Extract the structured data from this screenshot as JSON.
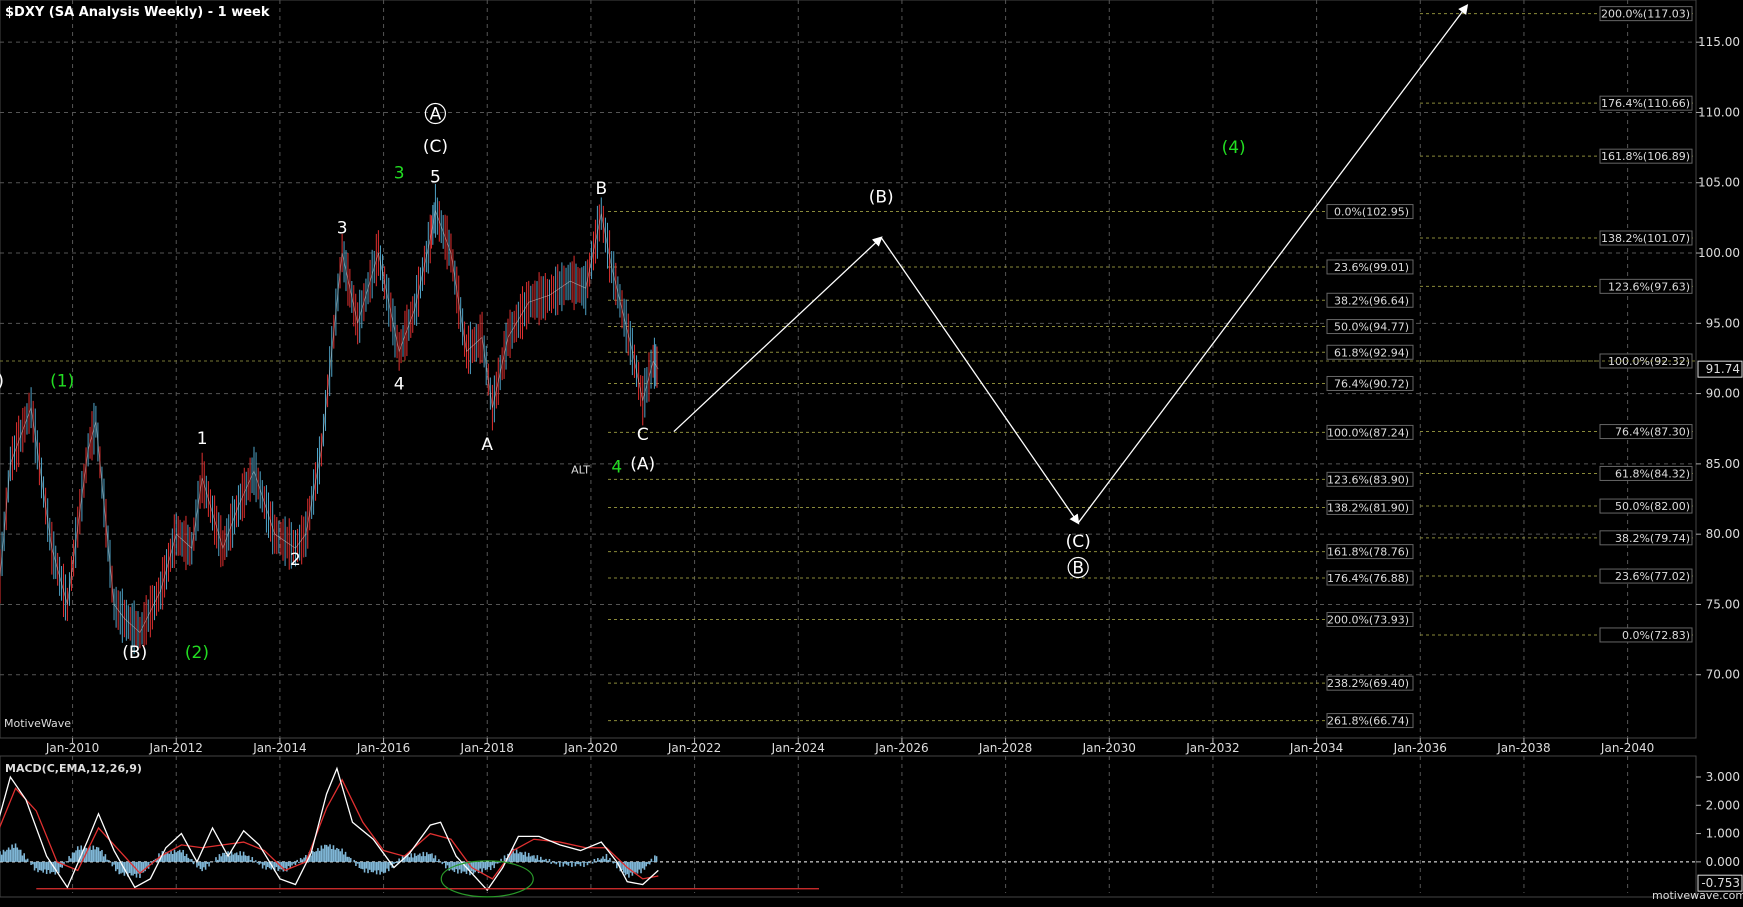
{
  "header": {
    "title": "$DXY (SA Analysis Weekly) - 1 week",
    "watermark": "MotiveWave",
    "footer_site": "motivewave.com",
    "last_price": "91.74"
  },
  "colors": {
    "background": "#000000",
    "grid": "#555555",
    "up_bar": "#4fa3c7",
    "down_bar": "#e03030",
    "fib_line": "#8a8a3a",
    "wave_label": "#ffffff",
    "alt_label": "#22dd22",
    "macd_line": "#ffffff",
    "signal_line": "#e03030",
    "histogram": "#7fb6d6"
  },
  "chart_data": {
    "type": "line",
    "title": "$DXY (SA Analysis Weekly) - 1 week",
    "x_axis": {
      "type": "date",
      "range": [
        "2008-06",
        "2041-06"
      ],
      "tick_labels": [
        "Jan-2010",
        "Jan-2012",
        "Jan-2014",
        "Jan-2016",
        "Jan-2018",
        "Jan-2020",
        "Jan-2022",
        "Jan-2024",
        "Jan-2026",
        "Jan-2028",
        "Jan-2030",
        "Jan-2032",
        "Jan-2034",
        "Jan-2036",
        "Jan-2038",
        "Jan-2040"
      ]
    },
    "y_axis": {
      "ylim": [
        65.5,
        118
      ],
      "tick_labels": [
        "70.00",
        "75.00",
        "80.00",
        "85.00",
        "90.00",
        "95.00",
        "100.00",
        "105.00",
        "110.00",
        "115.00"
      ]
    },
    "grid": true,
    "series": [
      {
        "values": [
          [
            2008.6,
            77
          ],
          [
            2008.8,
            85
          ],
          [
            2009.2,
            89
          ],
          [
            2009.6,
            79
          ],
          [
            2009.9,
            75
          ],
          [
            2010.3,
            86
          ],
          [
            2010.45,
            88
          ],
          [
            2010.8,
            75
          ],
          [
            2011.0,
            74
          ],
          [
            2011.3,
            73
          ],
          [
            2011.7,
            76
          ],
          [
            2012.0,
            80
          ],
          [
            2012.3,
            79
          ],
          [
            2012.5,
            84
          ],
          [
            2012.9,
            79
          ],
          [
            2013.2,
            82
          ],
          [
            2013.5,
            84.5
          ],
          [
            2013.9,
            80
          ],
          [
            2014.3,
            79
          ],
          [
            2014.5,
            80
          ],
          [
            2014.8,
            86
          ],
          [
            2015.0,
            93
          ],
          [
            2015.2,
            100
          ],
          [
            2015.5,
            95
          ],
          [
            2015.9,
            100
          ],
          [
            2016.3,
            93
          ],
          [
            2016.6,
            96
          ],
          [
            2016.9,
            101
          ],
          [
            2017.0,
            103
          ],
          [
            2017.3,
            100
          ],
          [
            2017.6,
            93
          ],
          [
            2017.9,
            94
          ],
          [
            2018.1,
            89
          ],
          [
            2018.4,
            94
          ],
          [
            2018.8,
            96.5
          ],
          [
            2019.2,
            97
          ],
          [
            2019.6,
            98
          ],
          [
            2019.9,
            97.5
          ],
          [
            2020.2,
            102.8
          ],
          [
            2020.4,
            99
          ],
          [
            2020.6,
            96
          ],
          [
            2020.8,
            93
          ],
          [
            2021.0,
            89.5
          ],
          [
            2021.2,
            92.3
          ],
          [
            2021.3,
            91.74
          ]
        ]
      }
    ],
    "projection_path": [
      [
        "2021.6",
        "87.3"
      ],
      [
        "2025.6",
        "101.1"
      ],
      [
        "2029.4",
        "80.8"
      ],
      [
        "2036.9",
        "117.6"
      ]
    ],
    "fib_left": [
      {
        "label": "0.0%(102.95)",
        "value": 102.95
      },
      {
        "label": "23.6%(99.01)",
        "value": 99.01
      },
      {
        "label": "38.2%(96.64)",
        "value": 96.64
      },
      {
        "label": "50.0%(94.77)",
        "value": 94.77
      },
      {
        "label": "61.8%(92.94)",
        "value": 92.94
      },
      {
        "label": "76.4%(90.72)",
        "value": 90.72
      },
      {
        "label": "100.0%(87.24)",
        "value": 87.24
      },
      {
        "label": "123.6%(83.90)",
        "value": 83.9
      },
      {
        "label": "138.2%(81.90)",
        "value": 81.9
      },
      {
        "label": "161.8%(78.76)",
        "value": 78.76
      },
      {
        "label": "176.4%(76.88)",
        "value": 76.88
      },
      {
        "label": "200.0%(73.93)",
        "value": 73.93
      },
      {
        "label": "238.2%(69.40)",
        "value": 69.4
      },
      {
        "label": "261.8%(66.74)",
        "value": 66.74
      }
    ],
    "fib_right": [
      {
        "label": "200.0%(117.03)",
        "value": 117.03
      },
      {
        "label": "176.4%(110.66)",
        "value": 110.66
      },
      {
        "label": "161.8%(106.89)",
        "value": 106.89
      },
      {
        "label": "138.2%(101.07)",
        "value": 101.07
      },
      {
        "label": "123.6%(97.63)",
        "value": 97.63
      },
      {
        "label": "100.0%(92.32)",
        "value": 92.32
      },
      {
        "label": "76.4%(87.30)",
        "value": 87.3
      },
      {
        "label": "61.8%(84.32)",
        "value": 84.32
      },
      {
        "label": "50.0%(82.00)",
        "value": 82.0
      },
      {
        "label": "38.2%(79.74)",
        "value": 79.74
      },
      {
        "label": "23.6%(77.02)",
        "value": 77.02
      },
      {
        "label": "0.0%(72.83)",
        "value": 72.83
      }
    ],
    "wave_labels": [
      {
        "text": "A)",
        "x": 2008.5,
        "y": 90.5,
        "style": "white"
      },
      {
        "text": "(1)",
        "x": 2009.8,
        "y": 90.5,
        "style": "green"
      },
      {
        "text": "(B)",
        "x": 2011.2,
        "y": 71.2,
        "style": "white"
      },
      {
        "text": "(2)",
        "x": 2012.4,
        "y": 71.2,
        "style": "green"
      },
      {
        "text": "1",
        "x": 2012.5,
        "y": 86.4,
        "style": "white"
      },
      {
        "text": "2",
        "x": 2014.3,
        "y": 77.8,
        "style": "white"
      },
      {
        "text": "3",
        "x": 2015.2,
        "y": 101.4,
        "style": "white"
      },
      {
        "text": "4",
        "x": 2016.3,
        "y": 90.3,
        "style": "white"
      },
      {
        "text": "3",
        "x": 2016.3,
        "y": 105.3,
        "style": "green"
      },
      {
        "text": "5",
        "x": 2017.0,
        "y": 105.0,
        "style": "white"
      },
      {
        "text": "(C)",
        "x": 2017.0,
        "y": 107.2,
        "style": "white"
      },
      {
        "text": "A",
        "x": 2017.0,
        "y": 109.5,
        "style": "circle"
      },
      {
        "text": "A",
        "x": 2018.0,
        "y": 86.0,
        "style": "white"
      },
      {
        "text": "B",
        "x": 2020.2,
        "y": 104.2,
        "style": "white"
      },
      {
        "text": "C",
        "x": 2021.0,
        "y": 86.7,
        "style": "white"
      },
      {
        "text": "(A)",
        "x": 2021.0,
        "y": 84.6,
        "style": "white"
      },
      {
        "text": "ALT",
        "x": 2019.8,
        "y": 84.3,
        "style": "green-small"
      },
      {
        "text": "4",
        "x": 2020.5,
        "y": 84.4,
        "style": "green"
      },
      {
        "text": "(B)",
        "x": 2025.6,
        "y": 103.6,
        "style": "white"
      },
      {
        "text": "(C)",
        "x": 2029.4,
        "y": 79.1,
        "style": "white"
      },
      {
        "text": "B",
        "x": 2029.4,
        "y": 77.2,
        "style": "circle"
      },
      {
        "text": "(4)",
        "x": 2032.4,
        "y": 107.1,
        "style": "green"
      }
    ],
    "macd": {
      "label": "MACD(C,EMA,12,26,9)",
      "ylim": [
        -1.1,
        3.6
      ],
      "tick_labels": [
        "3.000",
        "2.000",
        "1.000",
        "0.000"
      ],
      "current_value": "-0.753",
      "macd_line": [
        [
          2008.5,
          1.0
        ],
        [
          2008.8,
          3.0
        ],
        [
          2009.1,
          2.2
        ],
        [
          2009.5,
          0.2
        ],
        [
          2009.9,
          -0.9
        ],
        [
          2010.3,
          0.8
        ],
        [
          2010.5,
          1.7
        ],
        [
          2010.8,
          0.4
        ],
        [
          2011.2,
          -0.9
        ],
        [
          2011.5,
          -0.6
        ],
        [
          2011.8,
          0.5
        ],
        [
          2012.1,
          1.0
        ],
        [
          2012.4,
          0.0
        ],
        [
          2012.7,
          1.2
        ],
        [
          2013.0,
          0.2
        ],
        [
          2013.3,
          1.1
        ],
        [
          2013.6,
          0.6
        ],
        [
          2014.0,
          -0.6
        ],
        [
          2014.3,
          -0.8
        ],
        [
          2014.6,
          0.3
        ],
        [
          2014.9,
          2.4
        ],
        [
          2015.1,
          3.3
        ],
        [
          2015.4,
          1.4
        ],
        [
          2015.8,
          0.8
        ],
        [
          2016.2,
          -0.2
        ],
        [
          2016.5,
          0.3
        ],
        [
          2016.9,
          1.3
        ],
        [
          2017.1,
          1.4
        ],
        [
          2017.4,
          0.2
        ],
        [
          2017.8,
          -0.6
        ],
        [
          2018.0,
          -1.0
        ],
        [
          2018.3,
          -0.2
        ],
        [
          2018.6,
          0.9
        ],
        [
          2019.0,
          0.9
        ],
        [
          2019.4,
          0.6
        ],
        [
          2019.8,
          0.4
        ],
        [
          2020.2,
          0.7
        ],
        [
          2020.5,
          0.0
        ],
        [
          2020.7,
          -0.7
        ],
        [
          2021.0,
          -0.8
        ],
        [
          2021.3,
          -0.3
        ]
      ],
      "signal_line": [
        [
          2008.5,
          0.8
        ],
        [
          2008.9,
          2.6
        ],
        [
          2009.3,
          1.8
        ],
        [
          2009.7,
          0.0
        ],
        [
          2010.1,
          -0.3
        ],
        [
          2010.5,
          1.2
        ],
        [
          2010.9,
          0.4
        ],
        [
          2011.3,
          -0.4
        ],
        [
          2011.7,
          0.2
        ],
        [
          2012.1,
          0.6
        ],
        [
          2012.5,
          0.5
        ],
        [
          2012.9,
          0.6
        ],
        [
          2013.3,
          0.7
        ],
        [
          2013.7,
          0.4
        ],
        [
          2014.1,
          -0.3
        ],
        [
          2014.5,
          0.0
        ],
        [
          2014.9,
          1.9
        ],
        [
          2015.2,
          2.9
        ],
        [
          2015.6,
          1.4
        ],
        [
          2016.0,
          0.4
        ],
        [
          2016.4,
          0.2
        ],
        [
          2016.9,
          1.0
        ],
        [
          2017.3,
          0.8
        ],
        [
          2017.7,
          -0.2
        ],
        [
          2018.1,
          -0.6
        ],
        [
          2018.5,
          0.4
        ],
        [
          2018.9,
          0.8
        ],
        [
          2019.4,
          0.7
        ],
        [
          2019.9,
          0.5
        ],
        [
          2020.3,
          0.5
        ],
        [
          2020.7,
          -0.2
        ],
        [
          2021.0,
          -0.6
        ],
        [
          2021.3,
          -0.5
        ]
      ],
      "histogram": [
        [
          2008.5,
          0.2
        ],
        [
          2008.9,
          0.6
        ],
        [
          2009.3,
          -0.3
        ],
        [
          2009.7,
          -0.4
        ],
        [
          2010.1,
          0.5
        ],
        [
          2010.5,
          0.5
        ],
        [
          2010.9,
          -0.4
        ],
        [
          2011.3,
          -0.5
        ],
        [
          2011.7,
          0.3
        ],
        [
          2012.1,
          0.4
        ],
        [
          2012.5,
          -0.3
        ],
        [
          2012.9,
          0.3
        ],
        [
          2013.3,
          0.3
        ],
        [
          2013.7,
          -0.2
        ],
        [
          2014.1,
          -0.3
        ],
        [
          2014.5,
          0.2
        ],
        [
          2014.9,
          0.6
        ],
        [
          2015.2,
          0.4
        ],
        [
          2015.6,
          -0.3
        ],
        [
          2016.0,
          -0.4
        ],
        [
          2016.4,
          0.2
        ],
        [
          2016.9,
          0.3
        ],
        [
          2017.3,
          -0.3
        ],
        [
          2017.7,
          -0.4
        ],
        [
          2018.1,
          -0.2
        ],
        [
          2018.5,
          0.4
        ],
        [
          2018.9,
          0.2
        ],
        [
          2019.4,
          -0.1
        ],
        [
          2019.9,
          -0.1
        ],
        [
          2020.3,
          0.2
        ],
        [
          2020.7,
          -0.5
        ],
        [
          2021.0,
          -0.3
        ],
        [
          2021.3,
          0.3
        ]
      ],
      "divergence_level": -0.95
    }
  }
}
